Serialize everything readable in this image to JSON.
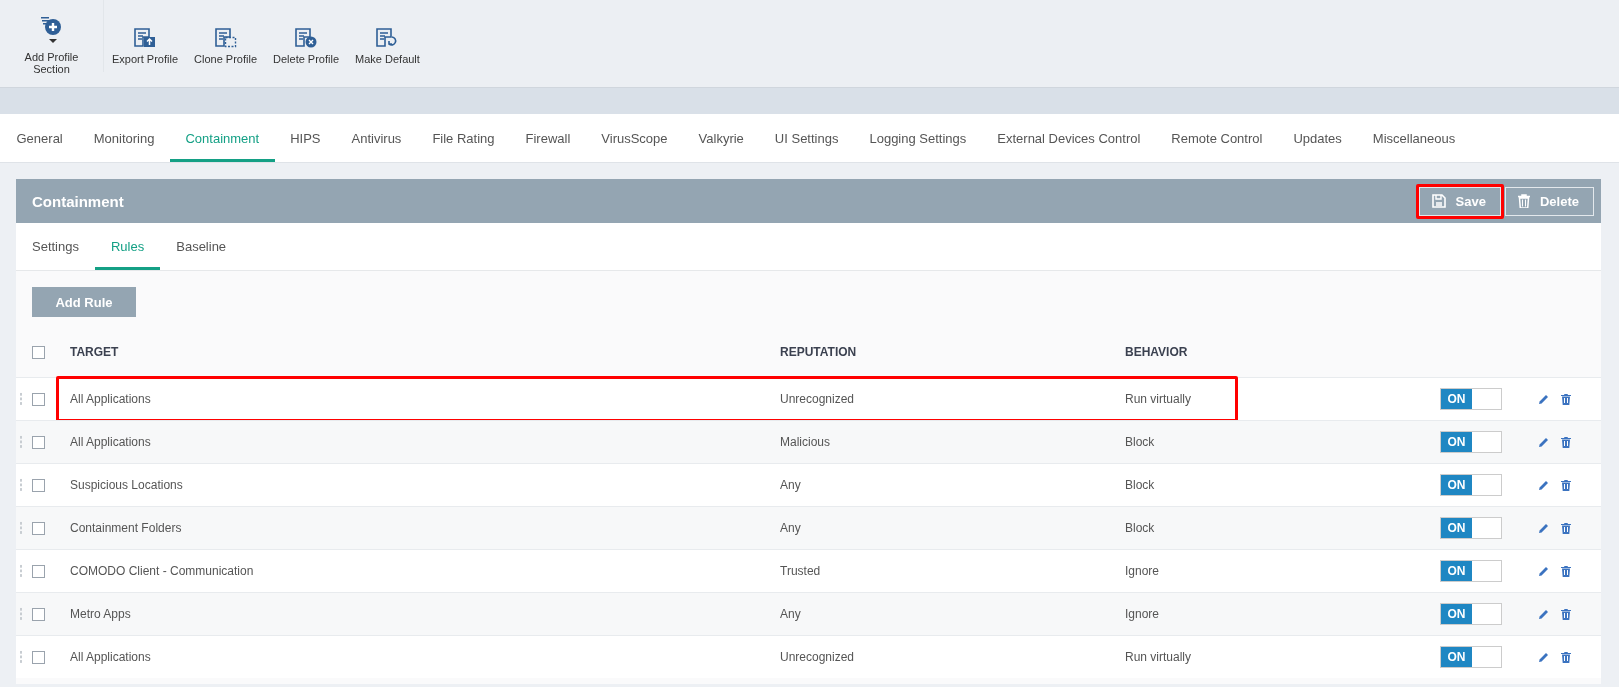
{
  "toolbar": [
    {
      "label": "Add Profile Section",
      "kind": "add"
    },
    {
      "label": "Export Profile",
      "kind": "export"
    },
    {
      "label": "Clone Profile",
      "kind": "clone"
    },
    {
      "label": "Delete Profile",
      "kind": "delete"
    },
    {
      "label": "Make Default",
      "kind": "default"
    }
  ],
  "tabs": [
    {
      "label": "General",
      "selected": false
    },
    {
      "label": "Monitoring",
      "selected": false
    },
    {
      "label": "Containment",
      "selected": true
    },
    {
      "label": "HIPS",
      "selected": false
    },
    {
      "label": "Antivirus",
      "selected": false
    },
    {
      "label": "File Rating",
      "selected": false
    },
    {
      "label": "Firewall",
      "selected": false
    },
    {
      "label": "VirusScope",
      "selected": false
    },
    {
      "label": "Valkyrie",
      "selected": false
    },
    {
      "label": "UI Settings",
      "selected": false
    },
    {
      "label": "Logging Settings",
      "selected": false
    },
    {
      "label": "External Devices Control",
      "selected": false
    },
    {
      "label": "Remote Control",
      "selected": false
    },
    {
      "label": "Updates",
      "selected": false
    },
    {
      "label": "Miscellaneous",
      "selected": false
    }
  ],
  "panel": {
    "title": "Containment",
    "buttons": [
      {
        "label": "Save",
        "kind": "save",
        "highlighted": true
      },
      {
        "label": "Delete",
        "kind": "delete",
        "highlighted": false
      }
    ],
    "subtabs": [
      {
        "label": "Settings",
        "selected": false
      },
      {
        "label": "Rules",
        "selected": true
      },
      {
        "label": "Baseline",
        "selected": false
      }
    ],
    "add_button": "Add Rule",
    "table": {
      "columns": [
        "TARGET",
        "REPUTATION",
        "BEHAVIOR"
      ],
      "select_all_checked": false,
      "rows": [
        {
          "target": "All Applications",
          "reputation": "Unrecognized",
          "behavior": "Run virtually",
          "checked": false,
          "on": true,
          "toggle_label": "ON",
          "highlighted": true
        },
        {
          "target": "All Applications",
          "reputation": "Malicious",
          "behavior": "Block",
          "checked": false,
          "on": true,
          "toggle_label": "ON",
          "highlighted": false
        },
        {
          "target": "Suspicious Locations",
          "reputation": "Any",
          "behavior": "Block",
          "checked": false,
          "on": true,
          "toggle_label": "ON",
          "highlighted": false
        },
        {
          "target": "Containment Folders",
          "reputation": "Any",
          "behavior": "Block",
          "checked": false,
          "on": true,
          "toggle_label": "ON",
          "highlighted": false
        },
        {
          "target": "COMODO Client - Communication",
          "reputation": "Trusted",
          "behavior": "Ignore",
          "checked": false,
          "on": true,
          "toggle_label": "ON",
          "highlighted": false
        },
        {
          "target": "Metro Apps",
          "reputation": "Any",
          "behavior": "Ignore",
          "checked": false,
          "on": true,
          "toggle_label": "ON",
          "highlighted": false
        },
        {
          "target": "All Applications",
          "reputation": "Unrecognized",
          "behavior": "Run virtually",
          "checked": false,
          "on": true,
          "toggle_label": "ON",
          "highlighted": false
        }
      ]
    }
  }
}
